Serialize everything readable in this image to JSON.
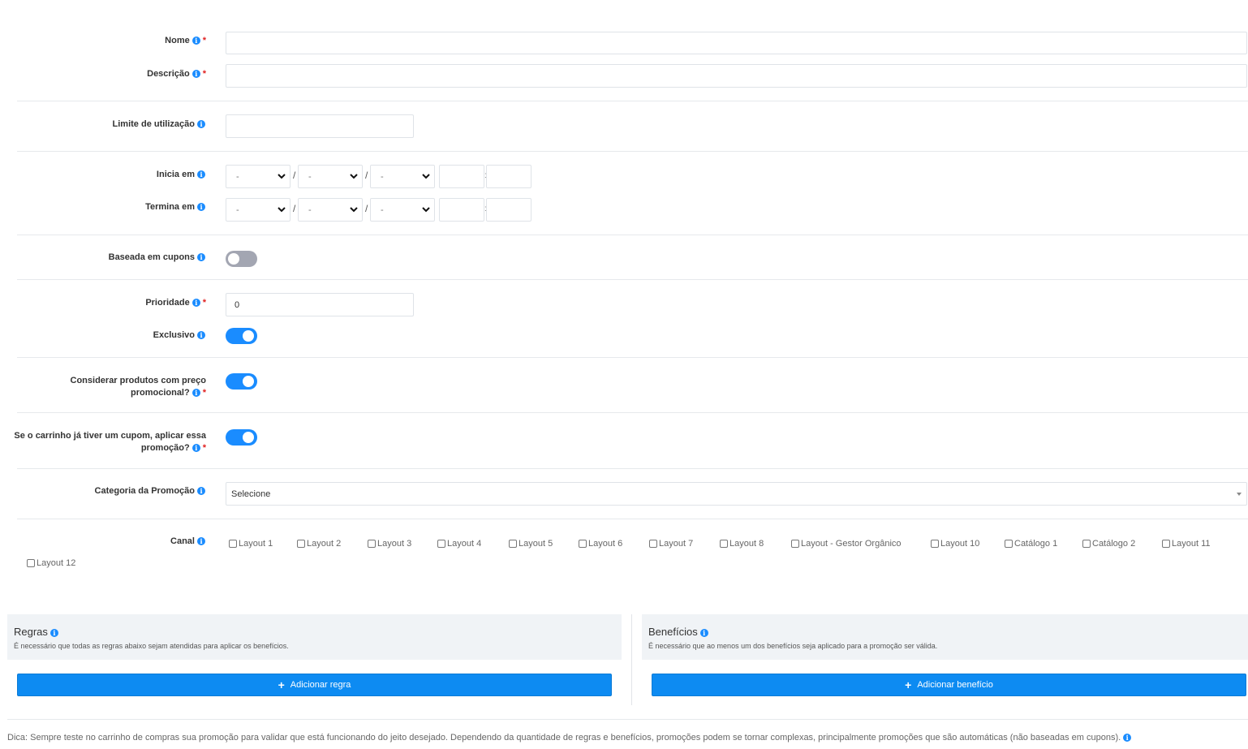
{
  "fields": {
    "nome": {
      "label": "Nome",
      "value": ""
    },
    "descricao": {
      "label": "Descrição",
      "value": ""
    },
    "limite": {
      "label": "Limite de utilização",
      "value": ""
    },
    "inicia": {
      "label": "Inicia em",
      "day": "-",
      "month": "-",
      "year": "-",
      "separator": "/",
      "time_sep": ":"
    },
    "termina": {
      "label": "Termina em",
      "day": "-",
      "month": "-",
      "year": "-",
      "separator": "/",
      "time_sep": ":"
    },
    "cupons": {
      "label": "Baseada em cupons",
      "checked": false
    },
    "prioridade": {
      "label": "Prioridade",
      "value": "0"
    },
    "exclusivo": {
      "label": "Exclusivo",
      "checked": true
    },
    "preco_promo": {
      "label": "Considerar produtos com preço promocional?",
      "checked": true
    },
    "carrinho_cupom": {
      "label": "Se o carrinho já tiver um cupom, aplicar essa promoção?",
      "checked": true
    },
    "categoria": {
      "label": "Categoria da Promoção",
      "value": "Selecione"
    },
    "canal": {
      "label": "Canal",
      "options": [
        "Layout 1",
        "Layout 2",
        "Layout 3",
        "Layout 4",
        "Layout 5",
        "Layout 6",
        "Layout 7",
        "Layout 8",
        "Layout - Gestor Orgânico",
        "Layout 10",
        "Catálogo 1",
        "Catálogo 2",
        "Layout 11",
        "Layout 12"
      ]
    }
  },
  "required_mark": "*",
  "info_glyph": "i",
  "regras": {
    "title": "Regras",
    "subtitle": "É necessário que todas as regras abaixo sejam atendidas para aplicar os benefícios.",
    "button": "Adicionar regra"
  },
  "beneficios": {
    "title": "Benefícios",
    "subtitle": "É necessário que ao menos um dos benefícios seja aplicado para a promoção ser válida.",
    "button": "Adicionar benefício"
  },
  "footer": "Dica: Sempre teste no carrinho de compras sua promoção para validar que está funcionando do jeito desejado. Dependendo da quantidade de regras e benefícios, promoções podem se tornar complexas, principalmente promoções que são automáticas (não baseadas em cupons).",
  "colors": {
    "accent": "#1a8cff",
    "button": "#0d8bf2",
    "required": "#e02020",
    "toggle_off": "#a3a6b2"
  }
}
